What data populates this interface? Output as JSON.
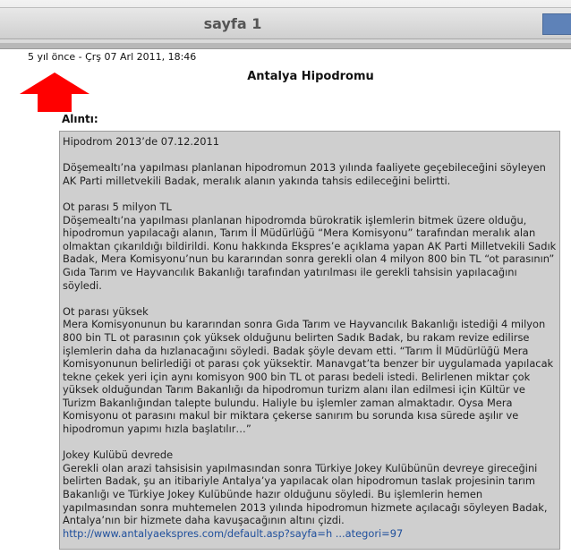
{
  "header": {
    "title": "sayfa 1"
  },
  "post": {
    "timestamp": "5 yıl önce - Çrş 07 Arl 2011, 18:46",
    "title": "Antalya Hipodromu",
    "quote_label": "Alıntı:",
    "paragraphs": [
      "Hipodrom 2013’de 07.12.2011",
      "Döşemealtı’na yapılması planlanan hipodromun 2013 yılında faaliyete geçebileceğini söyleyen AK Parti milletvekili Badak, meralık alanın yakında tahsis edileceğini belirtti.",
      "Ot parası 5 milyon TL\nDöşemealtı’na yapılması planlanan hipodromda bürokratik işlemlerin bitmek üzere olduğu, hipodromun yapılacağı alanın, Tarım İl Müdürlüğü “Mera Komisyonu” tarafından meralık alan olmaktan çıkarıldığı bildirildi. Konu hakkında Ekspres’e açıklama yapan AK Parti Milletvekili Sadık Badak, Mera Komisyonu’nun bu kararından sonra gerekli olan 4 milyon 800 bin TL “ot parasının” Gıda Tarım ve Hayvancılık Bakanlığı tarafından yatırılması ile gerekli tahsisin yapılacağını söyledi.",
      "Ot parası yüksek\nMera Komisyonunun bu kararından sonra Gıda Tarım ve Hayvancılık Bakanlığı istediği 4 milyon 800 bin TL ot parasının çok yüksek olduğunu belirten Sadık Badak, bu rakam revize edilirse işlemlerin daha da hızlanacağını söyledi. Badak şöyle devam etti. “Tarım İl Müdürlüğü Mera Komisyonunun belirlediği ot parası çok yüksektir. Manavgat’ta benzer bir uygulamada yapılacak tekne çekek yeri için aynı komisyon 900 bin TL ot parası bedeli istedi. Belirlenen miktar çok yüksek olduğundan Tarım Bakanlığı da hipodromun turizm alanı ilan edilmesi için Kültür ve Turizm Bakanlığından talepte bulundu. Haliyle bu işlemler zaman almaktadır. Oysa Mera Komisyonu ot parasını makul bir miktara çekerse sanırım bu sorunda kısa sürede aşılır ve hipodromun yapımı hızla başlatılır…”",
      "Jokey Kulübü devrede\nGerekli olan arazi tahsisisin yapılmasından sonra Türkiye Jokey Kulübünün devreye gireceğini belirten Badak, şu an itibariyle Antalya’ya yapılacak olan hipodromun taslak projesinin tarım Bakanlığı ve Türkiye Jokey Kulübünde hazır olduğunu söyledi. Bu işlemlerin hemen yapılmasından sonra muhtemelen 2013 yılında hipodromun hizmete açılacağı söyleyen Badak, Antalya’nın bir hizmete daha kavuşacağının altını çizdi."
    ],
    "link": "http://www.antalyaekspres.com/default.asp?sayfa=h ...ategori=97"
  },
  "colors": {
    "arrow": "#ff0000",
    "quote_bg": "#cfcfcf",
    "link": "#1f4f9c",
    "header_box": "#5e82b8"
  },
  "icons": {
    "arrow": "red-up-arrow-icon"
  }
}
